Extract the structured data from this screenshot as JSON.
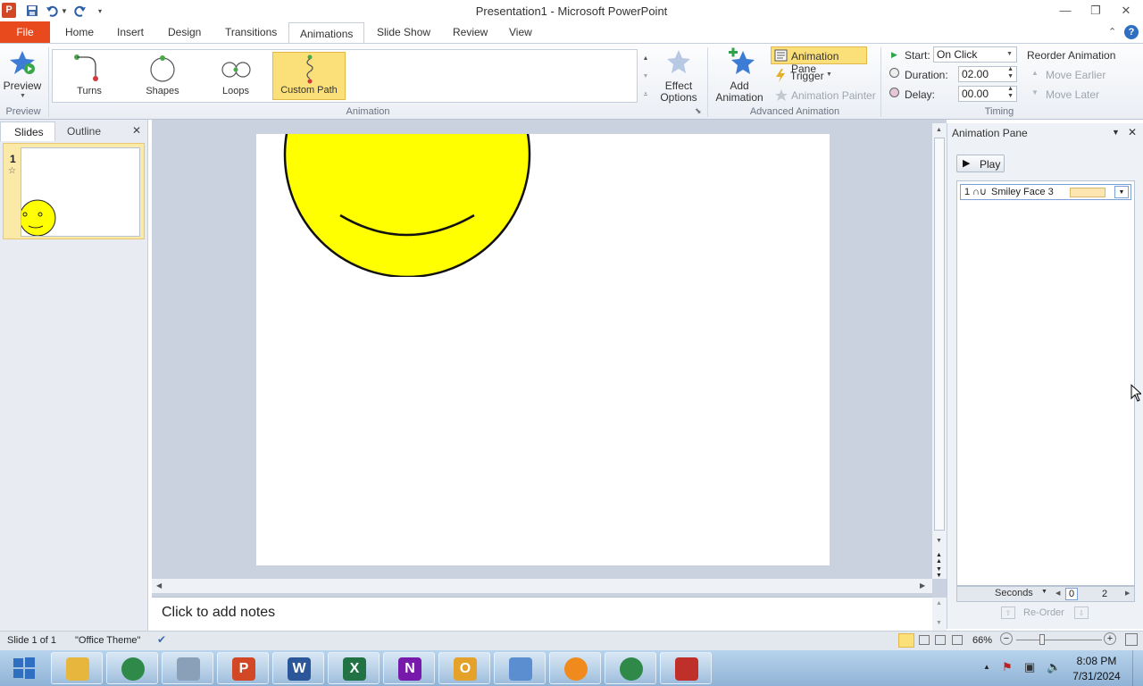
{
  "window": {
    "title": "Presentation1 - Microsoft PowerPoint"
  },
  "tabs": [
    {
      "label": "File"
    },
    {
      "label": "Home"
    },
    {
      "label": "Insert"
    },
    {
      "label": "Design"
    },
    {
      "label": "Transitions"
    },
    {
      "label": "Animations"
    },
    {
      "label": "Slide Show"
    },
    {
      "label": "Review"
    },
    {
      "label": "View"
    }
  ],
  "ribbon": {
    "preview": {
      "label": "Preview",
      "group": "Preview"
    },
    "gallery": {
      "group": "Animation",
      "items": [
        {
          "label": "Turns"
        },
        {
          "label": "Shapes"
        },
        {
          "label": "Loops"
        },
        {
          "label": "Custom Path"
        }
      ]
    },
    "effect_options": {
      "line1": "Effect",
      "line2": "Options"
    },
    "advanced": {
      "group": "Advanced Animation",
      "add_line1": "Add",
      "add_line2": "Animation",
      "animation_pane": "Animation Pane",
      "trigger": "Trigger",
      "animation_painter": "Animation Painter"
    },
    "timing": {
      "group": "Timing",
      "start_label": "Start:",
      "start_value": "On Click",
      "duration_label": "Duration:",
      "duration_value": "02.00",
      "delay_label": "Delay:",
      "delay_value": "00.00",
      "reorder": "Reorder Animation",
      "move_earlier": "Move Earlier",
      "move_later": "Move Later"
    }
  },
  "left_panel": {
    "tabs": [
      {
        "label": "Slides"
      },
      {
        "label": "Outline"
      }
    ],
    "slide_number": "1"
  },
  "notes": {
    "placeholder": "Click to add notes"
  },
  "animation_pane": {
    "title": "Animation Pane",
    "play": "Play",
    "items": [
      {
        "index": "1",
        "name": "Smiley Face 3"
      }
    ],
    "timeline": {
      "unit": "Seconds",
      "start": "0",
      "end": "2"
    },
    "reorder": "Re-Order"
  },
  "status": {
    "slide": "Slide 1 of 1",
    "theme": "\"Office Theme\"",
    "zoom": "66%"
  },
  "taskbar": {
    "time": "8:08 PM",
    "date": "7/31/2024",
    "apps": [
      "explorer",
      "chrome",
      "virtualbox",
      "powerpoint",
      "word",
      "excel",
      "onenote",
      "outlook",
      "remote-desktop",
      "vlc",
      "chrome",
      "toolbox"
    ]
  },
  "colors": {
    "accent_file": "#e84a1e",
    "selected": "#fbe07a",
    "smiley": "#ffff00"
  }
}
